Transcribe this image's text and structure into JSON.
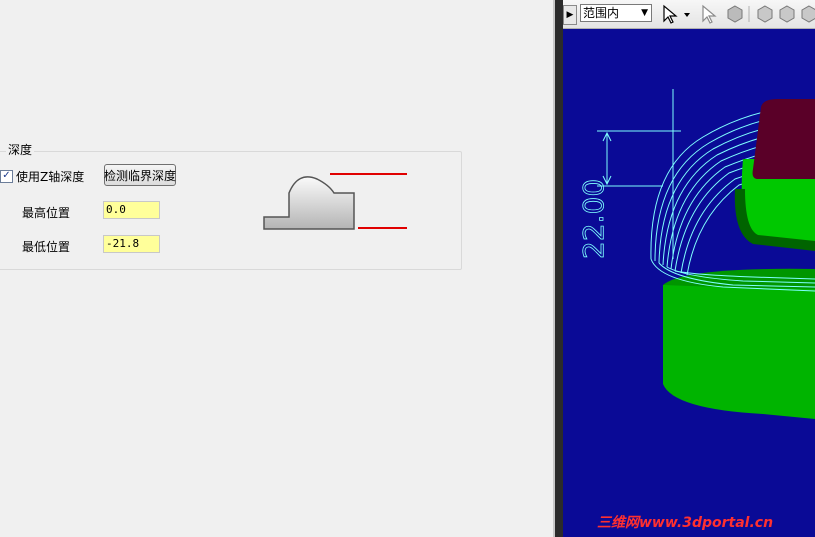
{
  "depth": {
    "group_title": "深度",
    "use_z_axis_label": "使用Z轴深度",
    "use_z_axis_checked": true,
    "check_glyph": "✓",
    "detect_button_label": "检测临界深度",
    "max_label": "最高位置",
    "max_value": "0.0",
    "min_label": "最低位置",
    "min_value": "-21.8",
    "field_color": "#ffff9a"
  },
  "toolbar": {
    "range_select_value": "范围内",
    "icons": [
      "grip-icon",
      "range-select-arrow-icon",
      "pointer-icon",
      "pointer-dropdown-icon",
      "select-pointer-icon",
      "shaded-hexagon-icon",
      "hexagon-1-icon",
      "hexagon-2-icon",
      "hexagon-3-icon"
    ]
  },
  "viewport": {
    "background_color": "#0a0a96",
    "dimension_text": "22.00",
    "part_colors": {
      "base": "#00c800",
      "top": "#5a0028",
      "toolpath": "#7fffff"
    }
  },
  "watermark": "三维网www.3dportal.cn"
}
